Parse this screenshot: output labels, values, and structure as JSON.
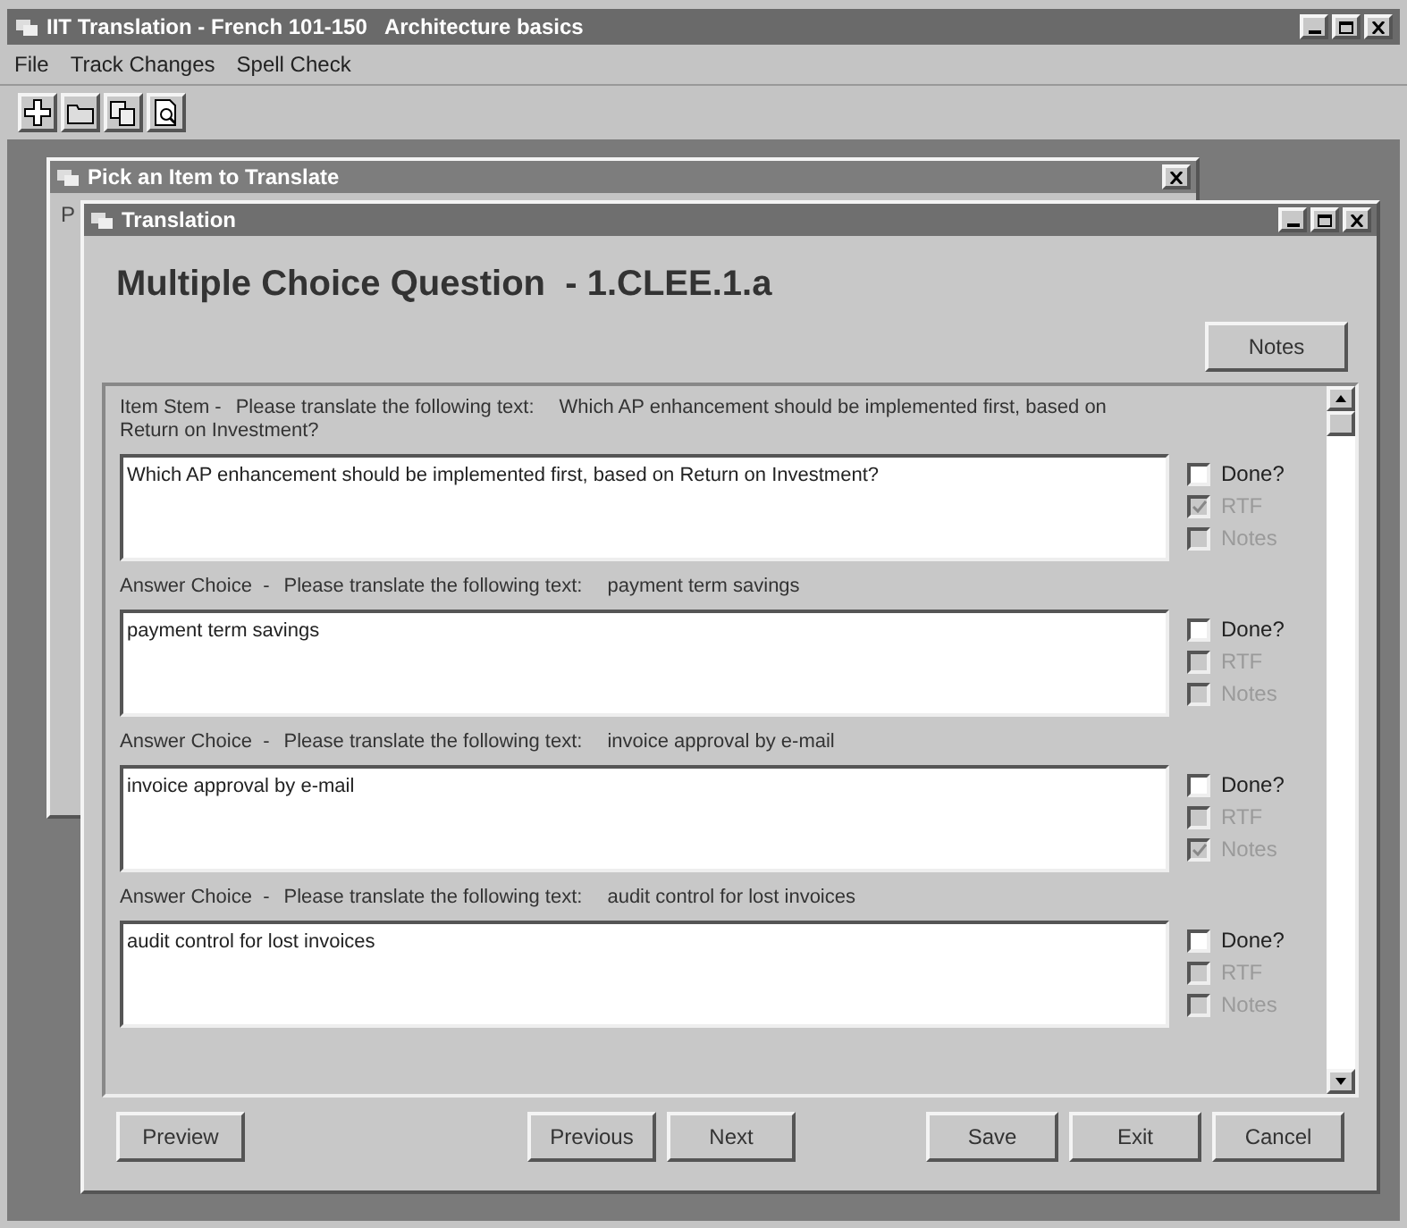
{
  "window": {
    "title": "IIT Translation - French 101-150   Architecture basics"
  },
  "menu": [
    "File",
    "Track Changes",
    "Spell Check"
  ],
  "toolbar": [
    {
      "kind": "new"
    },
    {
      "kind": "open"
    },
    {
      "kind": "copy"
    },
    {
      "kind": "preview"
    }
  ],
  "pick_window": {
    "title": "Pick an Item to Translate",
    "label": "P"
  },
  "translation_window": {
    "title": "Translation",
    "heading": "Multiple Choice Question  - 1.CLEE.1.a",
    "notes_button": "Notes",
    "items": [
      {
        "kind_label": "Item Stem -",
        "prompt": "Please translate the following text:",
        "source": "Which AP enhancement should be implemented first, based on Return on Investment?",
        "value": "Which AP enhancement should be implemented first, based on Return on Investment?",
        "checks": [
          {
            "label": "Done?",
            "checked": false,
            "disabled": false
          },
          {
            "label": "RTF",
            "checked": true,
            "disabled": true
          },
          {
            "label": "Notes",
            "checked": false,
            "disabled": true
          }
        ]
      },
      {
        "kind_label": "Answer Choice  -",
        "prompt": "Please translate the following text:",
        "source": "payment term savings",
        "value": "payment term savings",
        "checks": [
          {
            "label": "Done?",
            "checked": false,
            "disabled": false
          },
          {
            "label": "RTF",
            "checked": false,
            "disabled": true
          },
          {
            "label": "Notes",
            "checked": false,
            "disabled": true
          }
        ]
      },
      {
        "kind_label": "Answer Choice  -",
        "prompt": "Please translate the following text:",
        "source": "invoice approval by e-mail",
        "value": "invoice approval by e-mail",
        "checks": [
          {
            "label": "Done?",
            "checked": false,
            "disabled": false
          },
          {
            "label": "RTF",
            "checked": false,
            "disabled": true
          },
          {
            "label": "Notes",
            "checked": true,
            "disabled": true
          }
        ]
      },
      {
        "kind_label": "Answer Choice  -",
        "prompt": "Please translate the following text:",
        "source": "audit control for lost invoices",
        "value": "audit control for lost invoices",
        "checks": [
          {
            "label": "Done?",
            "checked": false,
            "disabled": false
          },
          {
            "label": "RTF",
            "checked": false,
            "disabled": true
          },
          {
            "label": "Notes",
            "checked": false,
            "disabled": true
          }
        ]
      }
    ],
    "buttons_left": [
      "Preview"
    ],
    "buttons_mid": [
      "Previous",
      "Next"
    ],
    "buttons_right": [
      "Save",
      "Exit",
      "Cancel"
    ]
  }
}
